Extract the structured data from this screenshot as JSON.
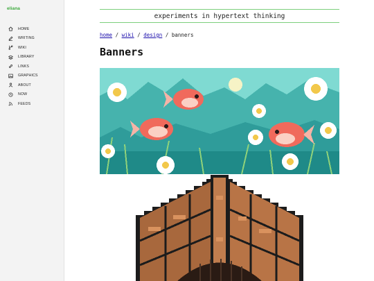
{
  "sidebar": {
    "brand": "eliana",
    "items": [
      {
        "label": "HOME",
        "icon": "home-icon"
      },
      {
        "label": "WRITING",
        "icon": "pen-icon"
      },
      {
        "label": "WIKI",
        "icon": "branch-icon"
      },
      {
        "label": "LIBRARY",
        "icon": "stack-icon"
      },
      {
        "label": "LINKS",
        "icon": "link-icon"
      },
      {
        "label": "GRAPHICS",
        "icon": "image-icon"
      },
      {
        "label": "ABOUT",
        "icon": "person-icon"
      },
      {
        "label": "NOW",
        "icon": "clock-icon"
      },
      {
        "label": "FEEDS",
        "icon": "rss-icon"
      }
    ]
  },
  "header": {
    "tagline": "experiments in hypertext thinking"
  },
  "breadcrumb": {
    "home": "home",
    "wiki": "wiki",
    "design": "design",
    "current": "banners",
    "sep": "/"
  },
  "page": {
    "title": "Banners"
  },
  "colors": {
    "accent": "#3aa83a",
    "link": "#1a0dab",
    "rule": "#7ccf7c"
  }
}
